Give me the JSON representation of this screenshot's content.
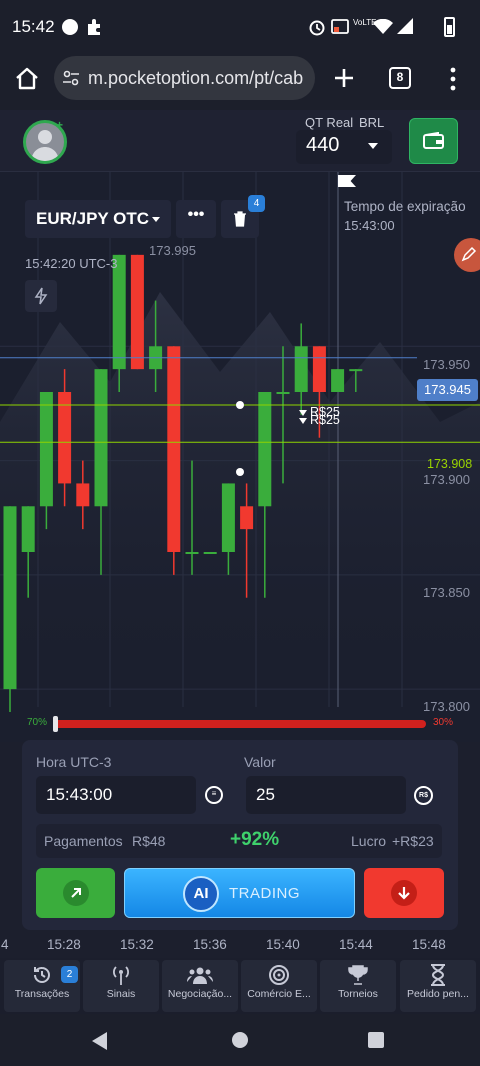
{
  "status_bar": {
    "time": "15:42",
    "network_label": "VoLTE"
  },
  "browser": {
    "url": "m.pocketoption.com/pt/cab",
    "tabs_count": "8"
  },
  "header": {
    "account_type": "QT Real",
    "currency": "BRL",
    "balance": "440"
  },
  "chart": {
    "asset": "EUR/JPY OTC",
    "notification_badge": "4",
    "time_label": "15:42:20 UTC-3",
    "crosshair_price": "173.995",
    "expiry_label": "Tempo de expiração",
    "expiry_time": "15:43:00",
    "price_ticks": [
      "173.950",
      "173.900",
      "173.850",
      "173.800"
    ],
    "current_price": "173.945",
    "green_line_price": "173.908",
    "trade_label_1": "R$25",
    "trade_label_2": "R$25",
    "sentiment_buy": "70%",
    "sentiment_sell": "30%",
    "sentiment_buy_fraction": 0.7,
    "time_axis": [
      "4",
      "15:28",
      "15:32",
      "15:36",
      "15:40",
      "15:44",
      "15:48"
    ]
  },
  "chart_data": {
    "type": "candlestick",
    "asset": "EUR/JPY OTC",
    "candles": [
      {
        "o": 173.8,
        "h": 173.88,
        "l": 173.79,
        "c": 173.88
      },
      {
        "o": 173.86,
        "h": 173.88,
        "l": 173.84,
        "c": 173.88
      },
      {
        "o": 173.88,
        "h": 173.93,
        "l": 173.87,
        "c": 173.93
      },
      {
        "o": 173.93,
        "h": 173.94,
        "l": 173.88,
        "c": 173.89
      },
      {
        "o": 173.89,
        "h": 173.9,
        "l": 173.87,
        "c": 173.88
      },
      {
        "o": 173.88,
        "h": 173.94,
        "l": 173.85,
        "c": 173.94
      },
      {
        "o": 173.94,
        "h": 173.99,
        "l": 173.93,
        "c": 173.99
      },
      {
        "o": 173.99,
        "h": 173.99,
        "l": 173.94,
        "c": 173.94
      },
      {
        "o": 173.94,
        "h": 173.97,
        "l": 173.93,
        "c": 173.95
      },
      {
        "o": 173.95,
        "h": 173.95,
        "l": 173.85,
        "c": 173.86
      },
      {
        "o": 173.86,
        "h": 173.9,
        "l": 173.85,
        "c": 173.86
      },
      {
        "o": 173.86,
        "h": 173.86,
        "l": 173.86,
        "c": 173.86
      },
      {
        "o": 173.86,
        "h": 173.89,
        "l": 173.85,
        "c": 173.89
      },
      {
        "o": 173.88,
        "h": 173.89,
        "l": 173.84,
        "c": 173.87
      },
      {
        "o": 173.88,
        "h": 173.93,
        "l": 173.84,
        "c": 173.93
      },
      {
        "o": 173.93,
        "h": 173.95,
        "l": 173.89,
        "c": 173.93
      },
      {
        "o": 173.93,
        "h": 173.96,
        "l": 173.92,
        "c": 173.95
      },
      {
        "o": 173.95,
        "h": 173.95,
        "l": 173.91,
        "c": 173.93
      },
      {
        "o": 173.93,
        "h": 173.94,
        "l": 173.93,
        "c": 173.94
      },
      {
        "o": 173.94,
        "h": 173.94,
        "l": 173.93,
        "c": 173.94
      }
    ],
    "ylim": [
      173.79,
      174.0
    ],
    "current_price": 173.945,
    "green_line": 173.908
  },
  "trade": {
    "time_label": "Hora UTC-3",
    "time_value": "15:43:00",
    "amount_label": "Valor",
    "amount_value": "25",
    "payout_label": "Pagamentos",
    "payout_value": "R$48",
    "payout_percent": "+92%",
    "profit_label": "Lucro",
    "profit_value": "+R$23",
    "ai_label": "AI",
    "ai_trading_label": "TRADING"
  },
  "nav": {
    "items": [
      {
        "label": "Transações",
        "badge": "2"
      },
      {
        "label": "Sinais"
      },
      {
        "label": "Negociação..."
      },
      {
        "label": "Comércio E..."
      },
      {
        "label": "Torneios"
      },
      {
        "label": "Pedido pen..."
      }
    ]
  },
  "colors": {
    "green": "#3aad3c",
    "red": "#f1392f",
    "accent_blue": "#2ba3f5",
    "bg": "#1b1f2e"
  }
}
